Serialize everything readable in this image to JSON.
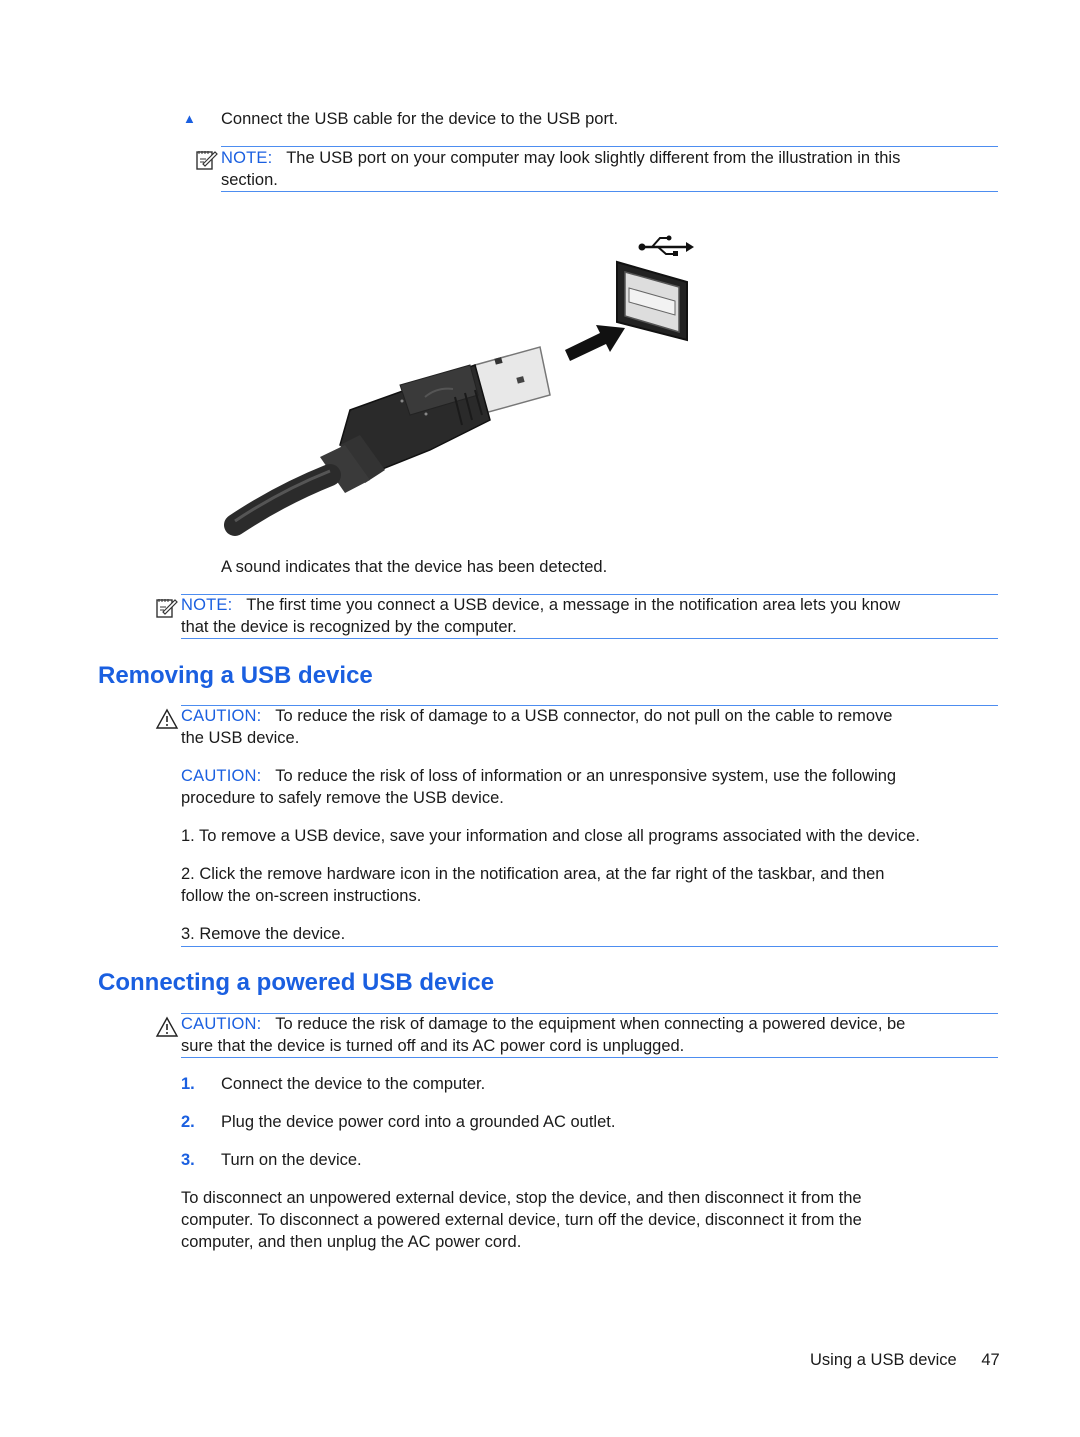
{
  "step_bullet": {
    "icon": "triangle-bullet-icon",
    "text": "Connect the USB cable for the device to the USB port."
  },
  "note1": {
    "icon": "note-icon",
    "label": "NOTE:",
    "text": "The USB port on your computer may look slightly different from the illustration in this",
    "text2": "section."
  },
  "illustration": {
    "alt": "USB cable connector being inserted into a USB port with a USB symbol and arrow",
    "symbol_icon": "usb-symbol-icon"
  },
  "detected_text": "A sound indicates that the device has been detected.",
  "note2": {
    "icon": "note-icon",
    "label": "NOTE:",
    "text": "The first time you connect a USB device, a message in the notification area lets you know",
    "text2": "that the device is recognized by the computer."
  },
  "section_removing": {
    "title": "Removing a USB device",
    "caution1": {
      "icon": "warning-icon",
      "label": "CAUTION:",
      "text": "To reduce the risk of damage to a USB connector, do not pull on the cable to remove",
      "text2": "the USB device."
    },
    "caution2": {
      "label": "CAUTION:",
      "text": "To reduce the risk of loss of information or an unresponsive system, use the following",
      "text2": "procedure to safely remove the USB device."
    },
    "steps": [
      {
        "text": "1. To remove a USB device, save your information and close all programs associated with the device."
      },
      {
        "text": "2. Click the remove hardware icon in the notification area, at the far right of the taskbar, and then",
        "text2": "follow the on-screen instructions."
      },
      {
        "text": "3. Remove the device."
      }
    ]
  },
  "section_connecting": {
    "title": "Connecting a powered USB device",
    "caution": {
      "icon": "warning-icon",
      "label": "CAUTION:",
      "text": "To reduce the risk of damage to the equipment when connecting a powered device, be",
      "text2": "sure that the device is turned off and its AC power cord is unplugged."
    },
    "steps": [
      {
        "num": "1.",
        "text": "Connect the device to the computer."
      },
      {
        "num": "2.",
        "text": "Plug the device power cord into a grounded AC outlet."
      },
      {
        "num": "3.",
        "text": "Turn on the device."
      }
    ],
    "paragraph": [
      "To disconnect an unpowered external device, stop the device, and then disconnect it from the",
      "computer. To disconnect a powered external device, turn off the device, disconnect it from the",
      "computer, and then unplug the AC power cord."
    ]
  },
  "footer": {
    "section": "Using a USB device",
    "page": "47"
  },
  "colors": {
    "accent": "#1a5fe0",
    "rule": "#4d8df0",
    "text": "#1a1a1a"
  }
}
